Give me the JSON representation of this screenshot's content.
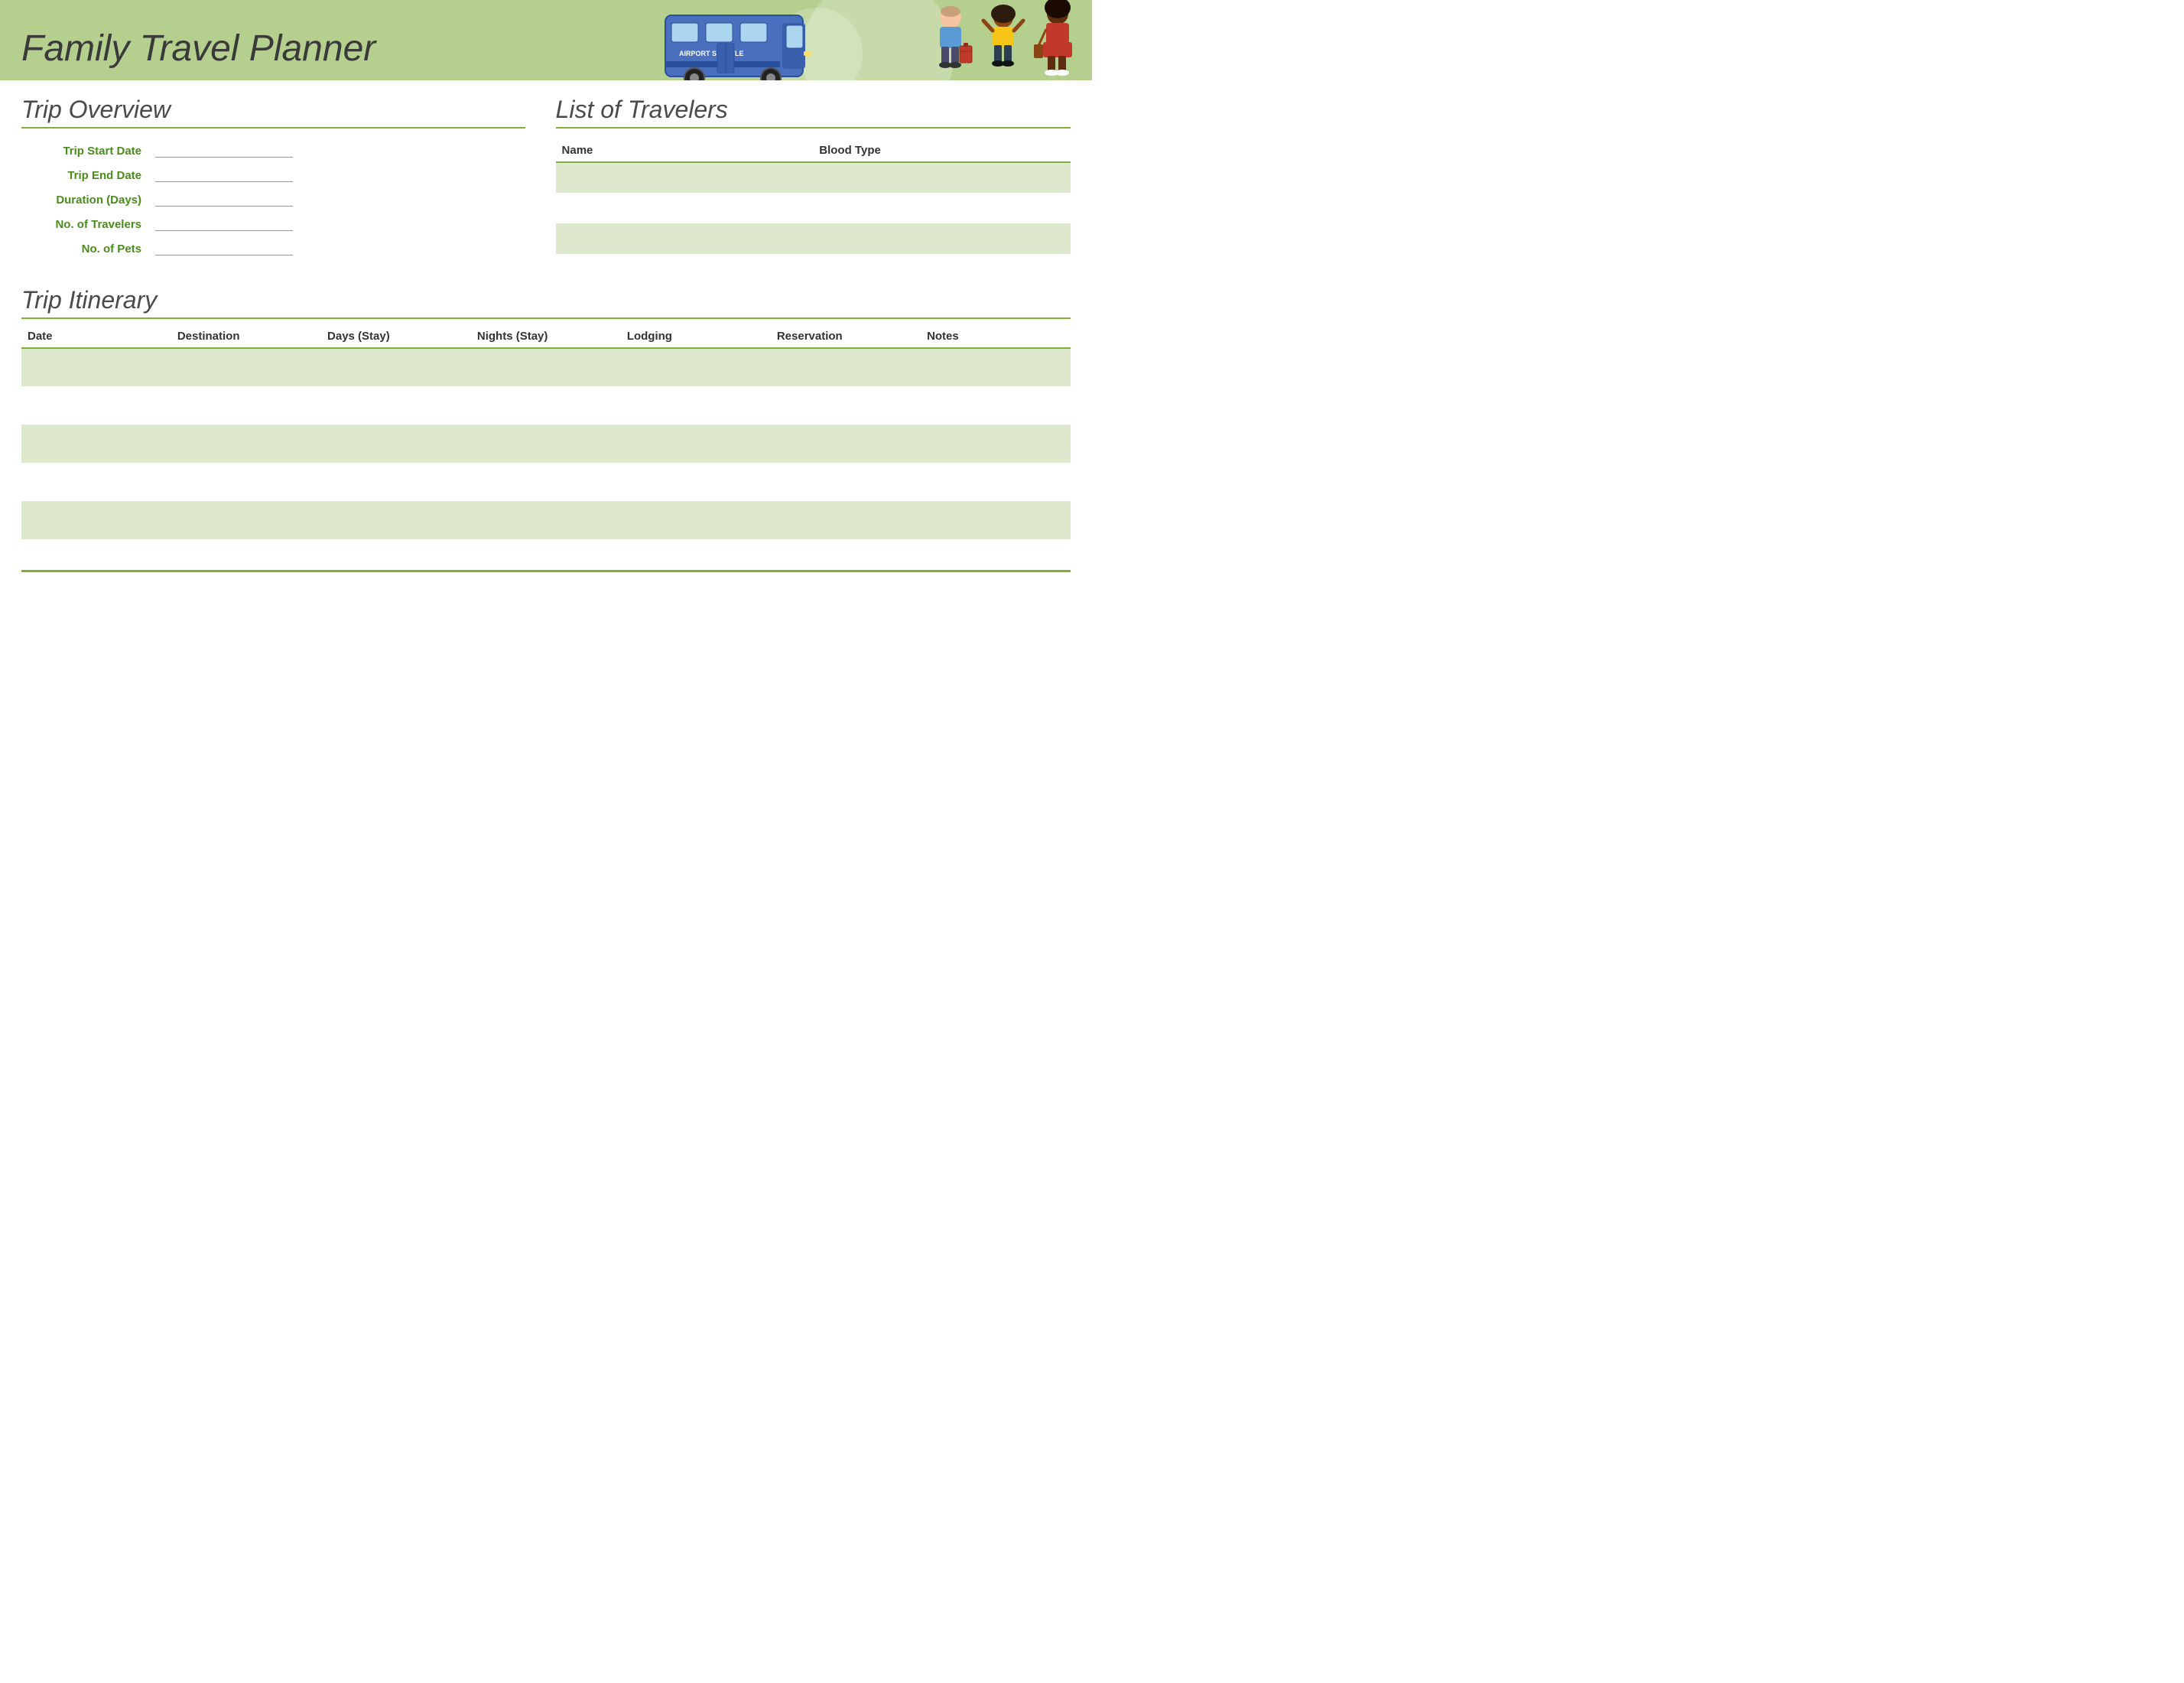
{
  "header": {
    "title": "Family Travel Planner",
    "illustration_label": "AIRPORT SHUTTLE"
  },
  "trip_overview": {
    "section_title": "Trip Overview",
    "fields": [
      {
        "label": "Trip Start Date",
        "id": "trip-start-date"
      },
      {
        "label": "Trip End Date",
        "id": "trip-end-date"
      },
      {
        "label": "Duration (Days)",
        "id": "duration-days"
      },
      {
        "label": "No. of Travelers",
        "id": "no-travelers"
      },
      {
        "label": "No. of Pets",
        "id": "no-pets"
      }
    ]
  },
  "list_travelers": {
    "section_title": "List of Travelers",
    "columns": [
      "Name",
      "Blood Type"
    ],
    "rows": [
      {
        "name": "",
        "blood_type": ""
      },
      {
        "name": "",
        "blood_type": ""
      },
      {
        "name": "",
        "blood_type": ""
      }
    ]
  },
  "trip_itinerary": {
    "section_title": "Trip Itinerary",
    "columns": [
      "Date",
      "Destination",
      "Days (Stay)",
      "Nights (Stay)",
      "Lodging",
      "Reservation",
      "Notes"
    ],
    "rows": [
      {
        "date": "",
        "destination": "",
        "days_stay": "",
        "nights_stay": "",
        "lodging": "",
        "reservation": "",
        "notes": ""
      },
      {
        "date": "",
        "destination": "",
        "days_stay": "",
        "nights_stay": "",
        "lodging": "",
        "reservation": "",
        "notes": ""
      },
      {
        "date": "",
        "destination": "",
        "days_stay": "",
        "nights_stay": "",
        "lodging": "",
        "reservation": "",
        "notes": ""
      },
      {
        "date": "",
        "destination": "",
        "days_stay": "",
        "nights_stay": "",
        "lodging": "",
        "reservation": "",
        "notes": ""
      },
      {
        "date": "",
        "destination": "",
        "days_stay": "",
        "nights_stay": "",
        "lodging": "",
        "reservation": "",
        "notes": ""
      }
    ]
  }
}
